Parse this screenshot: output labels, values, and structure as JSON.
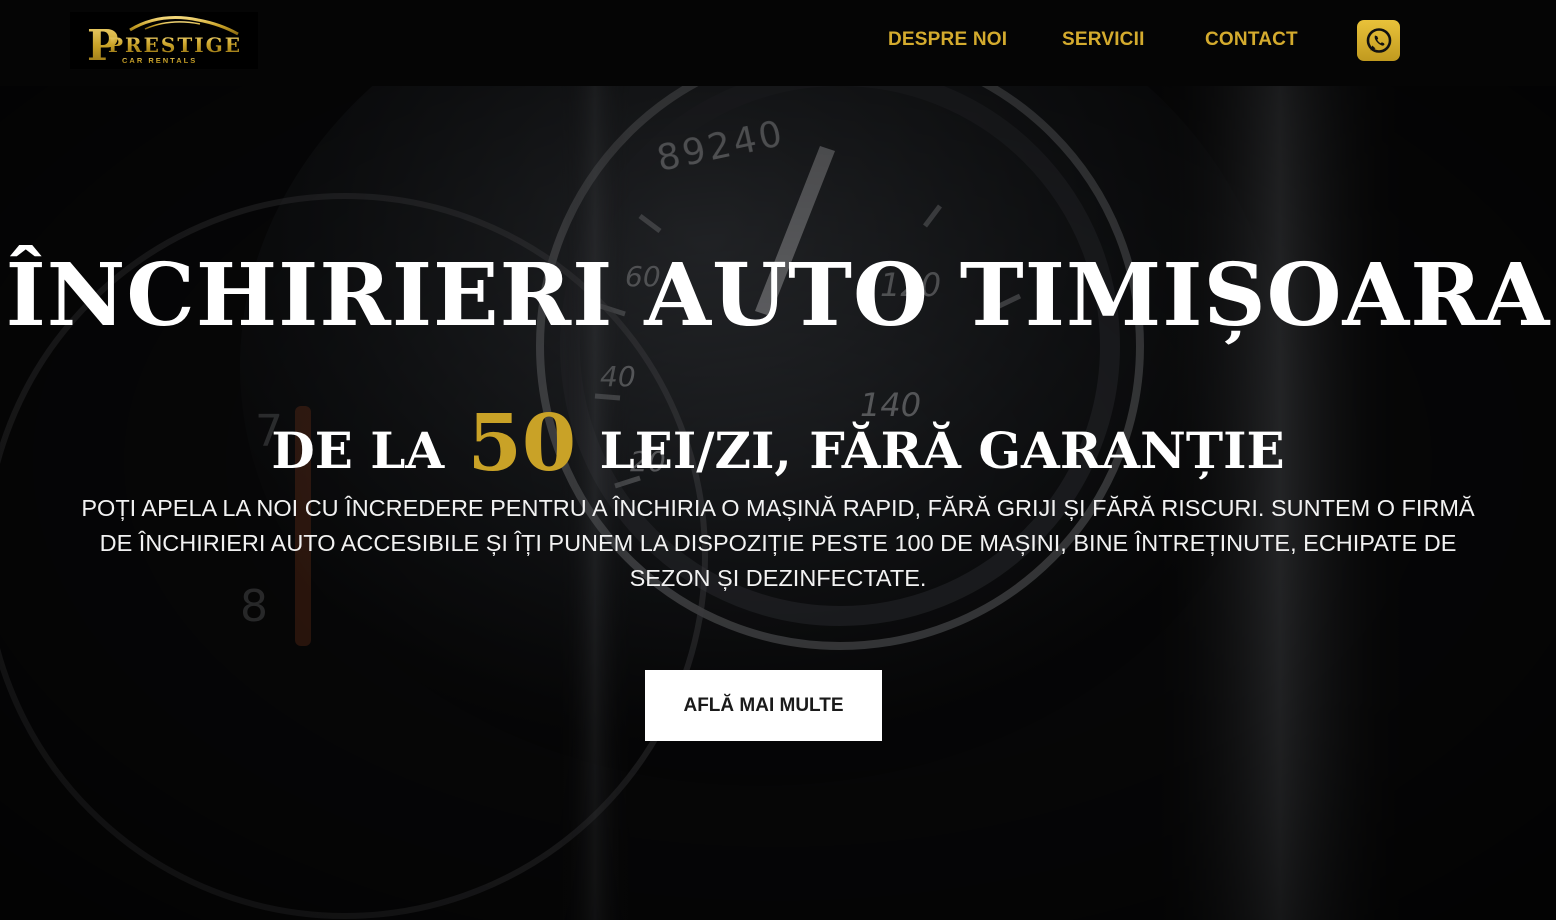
{
  "header": {
    "logo": {
      "main_text": "PRESTIGE",
      "sub_text": "CAR RENTALS"
    },
    "nav": [
      {
        "label": "DESPRE NOI"
      },
      {
        "label": "SERVICII"
      },
      {
        "label": "CONTACT"
      }
    ],
    "whatsapp_icon": "whatsapp-icon"
  },
  "hero": {
    "background_icon": "car-dashboard-speedometer",
    "odometer": "89240",
    "title": "ÎNCHIRIERI AUTO TIMIȘOARA",
    "subtitle_prefix": "DE LA",
    "subtitle_price": "50",
    "subtitle_suffix": "LEI/ZI, FĂRĂ GARANȚIE",
    "description": "POȚI APELA LA NOI CU ÎNCREDERE PENTRU A ÎNCHIRIA O MAȘINĂ RAPID, FĂRĂ GRIJI ȘI FĂRĂ RISCURI. SUNTEM O FIRMĂ DE ÎNCHIRIERI AUTO ACCESIBILE ȘI ÎȚI PUNEM LA DISPOZIȚIE PESTE 100 DE MAȘINI, BINE ÎNTREȚINUTE, ECHIPATE DE SEZON ȘI DEZINFECTATE.",
    "cta_label": "AFLĂ MAI MULTE"
  },
  "colors": {
    "accent_gold": "#c9a227",
    "nav_gold": "#d4ab2e",
    "header_bg": "#050505",
    "cta_bg": "#ffffff"
  }
}
